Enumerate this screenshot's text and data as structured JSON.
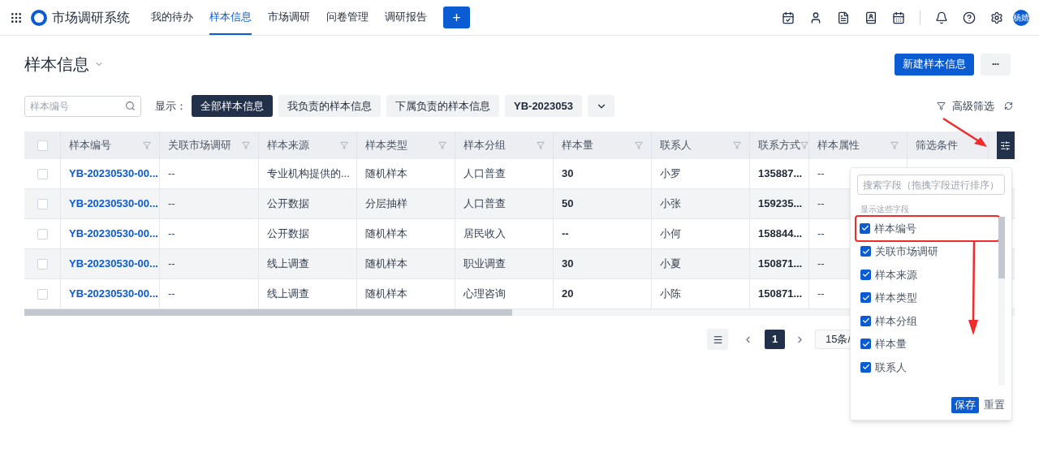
{
  "app": {
    "title": "市场调研系统",
    "avatar": "杨婧"
  },
  "nav": [
    {
      "label": "我的待办",
      "selected": false
    },
    {
      "label": "样本信息",
      "selected": true
    },
    {
      "label": "市场调研",
      "selected": false
    },
    {
      "label": "问卷管理",
      "selected": false
    },
    {
      "label": "调研报告",
      "selected": false
    }
  ],
  "add_button": "+",
  "page": {
    "title": "样本信息",
    "new_button": "新建样本信息",
    "more_button": "•••"
  },
  "filters": {
    "search_placeholder": "样本编号",
    "show_label": "显示：",
    "views": [
      {
        "label": "全部样本信息",
        "selected": true
      },
      {
        "label": "我负责的样本信息",
        "selected": false
      },
      {
        "label": "下属负责的样本信息",
        "selected": false
      },
      {
        "label": "YB-2023053",
        "selected": false
      }
    ],
    "advanced": "高级筛选"
  },
  "table": {
    "columns": [
      {
        "label": "样本编号",
        "kind": "link"
      },
      {
        "label": "关联市场调研",
        "kind": "text"
      },
      {
        "label": "样本来源",
        "kind": "text"
      },
      {
        "label": "样本类型",
        "kind": "text"
      },
      {
        "label": "样本分组",
        "kind": "text"
      },
      {
        "label": "样本量",
        "kind": "bold"
      },
      {
        "label": "联系人",
        "kind": "text"
      },
      {
        "label": "联系方式",
        "kind": "bold"
      },
      {
        "label": "样本属性",
        "kind": "text"
      },
      {
        "label": "筛选条件"
      }
    ],
    "all_checked": false,
    "rows": [
      {
        "checked": false,
        "cells": [
          "YB-20230530-00...",
          "--",
          "专业机构提供的...",
          "随机样本",
          "人口普查",
          "30",
          "小罗",
          "135887...",
          "--"
        ]
      },
      {
        "checked": false,
        "cells": [
          "YB-20230530-00...",
          "--",
          "公开数据",
          "分层抽样",
          "人口普查",
          "50",
          "小张",
          "159235...",
          "--"
        ]
      },
      {
        "checked": false,
        "cells": [
          "YB-20230530-00...",
          "--",
          "公开数据",
          "随机样本",
          "居民收入",
          "--",
          "小何",
          "158844...",
          "--"
        ]
      },
      {
        "checked": false,
        "cells": [
          "YB-20230530-00...",
          "--",
          "线上调查",
          "随机样本",
          "职业调查",
          "30",
          "小夏",
          "150871...",
          "--"
        ]
      },
      {
        "checked": false,
        "cells": [
          "YB-20230530-00...",
          "--",
          "线上调查",
          "随机样本",
          "心理咨询",
          "20",
          "小陈",
          "150871...",
          "--"
        ]
      }
    ]
  },
  "pagination": {
    "pages": [
      {
        "label": "1",
        "selected": true
      }
    ],
    "page_size": "15条/"
  },
  "field_panel": {
    "search_placeholder": "搜索字段（拖拽字段进行排序）",
    "section": "显示这些字段",
    "fields": [
      {
        "label": "样本编号",
        "checked": true
      },
      {
        "label": "关联市场调研",
        "checked": true
      },
      {
        "label": "样本来源",
        "checked": true
      },
      {
        "label": "样本类型",
        "checked": true
      },
      {
        "label": "样本分组",
        "checked": true
      },
      {
        "label": "样本量",
        "checked": true
      },
      {
        "label": "联系人",
        "checked": true
      }
    ],
    "save": "保存",
    "reset": "重置"
  }
}
